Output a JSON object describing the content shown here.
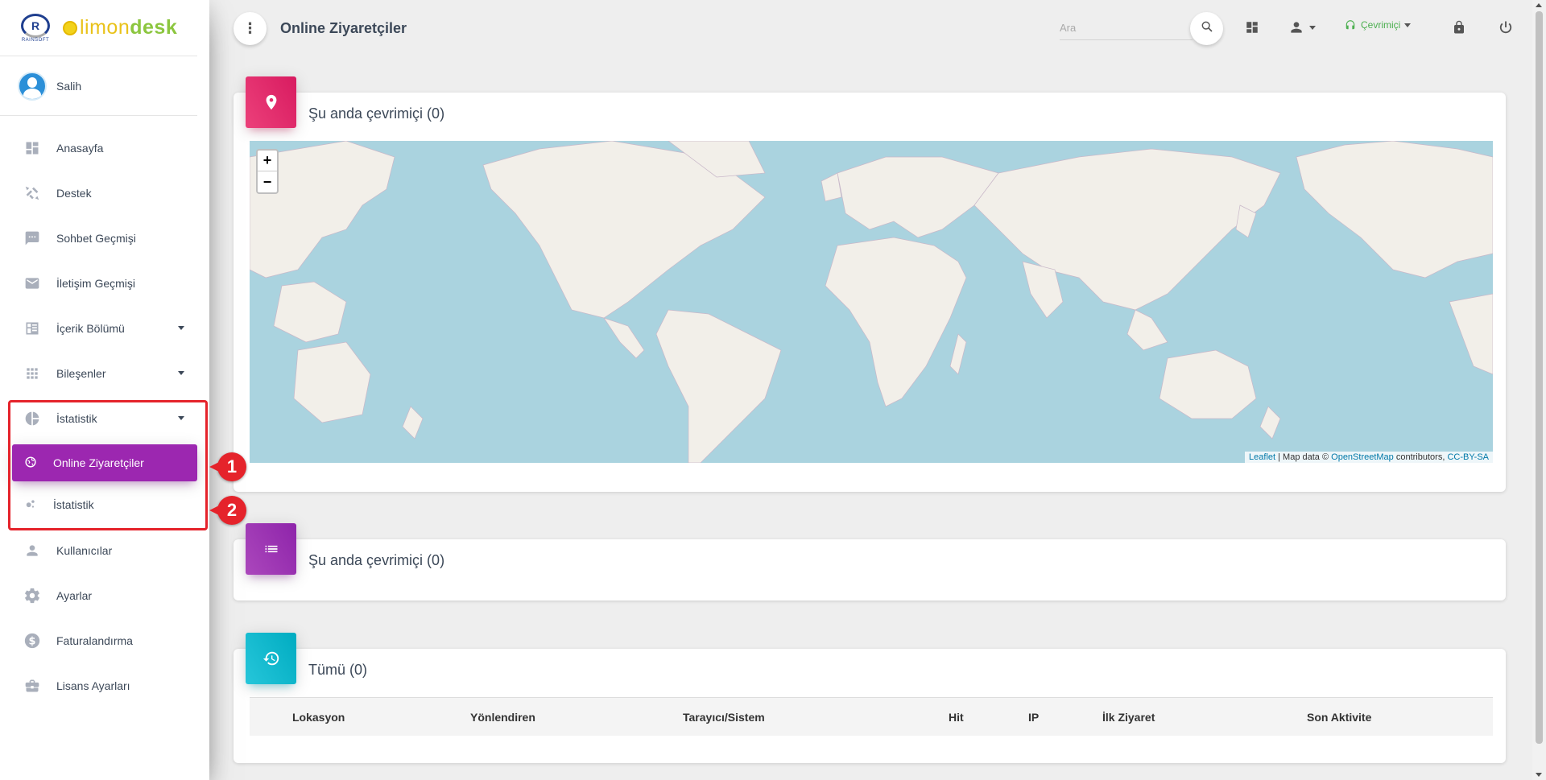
{
  "brand": {
    "name_part1": "limon",
    "name_part2": "desk",
    "mark_text": "RAINSOFT"
  },
  "user": {
    "name": "Salih"
  },
  "sidebar": {
    "items": [
      {
        "label": "Anasayfa",
        "icon": "dashboard-icon"
      },
      {
        "label": "Destek",
        "icon": "support-icon"
      },
      {
        "label": "Sohbet Geçmişi",
        "icon": "chat-icon"
      },
      {
        "label": "İletişim Geçmişi",
        "icon": "mail-icon"
      },
      {
        "label": "İçerik Bölümü",
        "icon": "content-icon",
        "expandable": true
      },
      {
        "label": "Bileşenler",
        "icon": "apps-icon",
        "expandable": true
      },
      {
        "label": "İstatistik",
        "icon": "pie-chart-icon",
        "expandable": true,
        "expanded": true
      },
      {
        "label": "Kullanıcılar",
        "icon": "person-icon"
      },
      {
        "label": "Ayarlar",
        "icon": "gear-icon"
      },
      {
        "label": "Faturalandırma",
        "icon": "dollar-icon"
      },
      {
        "label": "Lisans Ayarları",
        "icon": "briefcase-icon"
      }
    ],
    "sub_items": [
      {
        "label": "Online Ziyaretçiler",
        "active": true
      },
      {
        "label": "İstatistik",
        "active": false
      }
    ]
  },
  "callouts": [
    "1",
    "2"
  ],
  "topbar": {
    "title": "Online Ziyaretçiler",
    "search_placeholder": "Ara",
    "status_label": "Çevrimiçi"
  },
  "cards": {
    "map_card": {
      "title": "Şu anda çevrimiçi (0)"
    },
    "list_card": {
      "title": "Şu anda çevrimiçi (0)"
    },
    "all_card": {
      "title": "Tümü (0)"
    }
  },
  "map": {
    "zoom_in": "+",
    "zoom_out": "−",
    "attribution_leaflet": "Leaflet",
    "attribution_mid": " | Map data © ",
    "attribution_osm": "OpenStreetMap",
    "attribution_contrib": " contributors, ",
    "attribution_license": "CC-BY-SA"
  },
  "table": {
    "columns": [
      "Lokasyon",
      "Yönlendiren",
      "Tarayıcı/Sistem",
      "Hit",
      "IP",
      "İlk Ziyaret",
      "Son Aktivite"
    ]
  },
  "colors": {
    "accent_purple": "#9c27b0",
    "rose": "#e91e63",
    "info": "#00bcd4",
    "status_green": "#4caf50",
    "highlight_red": "#e5232b"
  }
}
